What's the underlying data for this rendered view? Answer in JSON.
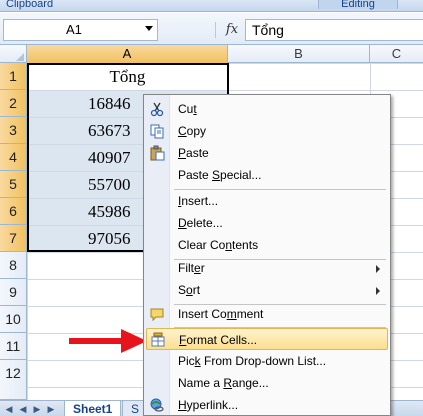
{
  "ribbon": {
    "clipboard_label": "Clipboard",
    "editing_label": "Editing"
  },
  "formula_bar": {
    "name_box": "A1",
    "fx_label": "fx",
    "content": "Tổng"
  },
  "columns": [
    "A",
    "B",
    "C"
  ],
  "rows": [
    "1",
    "2",
    "3",
    "4",
    "5",
    "6",
    "7",
    "8",
    "9",
    "10",
    "11",
    "12"
  ],
  "cells": {
    "header": "Tổng",
    "values": [
      "16846",
      "63673",
      "40907",
      "55700",
      "45986",
      "97056"
    ]
  },
  "context_menu": {
    "items": [
      {
        "pre": "Cu",
        "ul": "t",
        "post": "",
        "icon": "scissors-icon"
      },
      {
        "pre": "",
        "ul": "C",
        "post": "opy",
        "icon": "copy-icon"
      },
      {
        "pre": "",
        "ul": "P",
        "post": "aste",
        "icon": "paste-icon"
      },
      {
        "pre": "Paste ",
        "ul": "S",
        "post": "pecial...",
        "icon": ""
      },
      {
        "pre": "",
        "ul": "I",
        "post": "nsert...",
        "icon": ""
      },
      {
        "pre": "",
        "ul": "D",
        "post": "elete...",
        "icon": ""
      },
      {
        "pre": "Clear Co",
        "ul": "n",
        "post": "tents",
        "icon": ""
      },
      {
        "pre": "Filt",
        "ul": "e",
        "post": "r",
        "icon": "",
        "submenu": true
      },
      {
        "pre": "S",
        "ul": "o",
        "post": "rt",
        "icon": "",
        "submenu": true
      },
      {
        "pre": "Insert Co",
        "ul": "m",
        "post": "ment",
        "icon": "comment-icon"
      },
      {
        "pre": "",
        "ul": "F",
        "post": "ormat Cells...",
        "icon": "format-cells-icon",
        "highlight": true
      },
      {
        "pre": "Pic",
        "ul": "k",
        "post": " From Drop-down List...",
        "icon": ""
      },
      {
        "pre": "Name a ",
        "ul": "R",
        "post": "ange...",
        "icon": ""
      },
      {
        "pre": "",
        "ul": "H",
        "post": "yperlink...",
        "icon": "hyperlink-icon"
      }
    ]
  },
  "sheet_tabs": [
    "Sheet1",
    "S"
  ],
  "colors": {
    "accent_arrow": "#e8141c",
    "selection_fill": "#dce6f1",
    "menu_highlight": "#fbdf8e"
  }
}
